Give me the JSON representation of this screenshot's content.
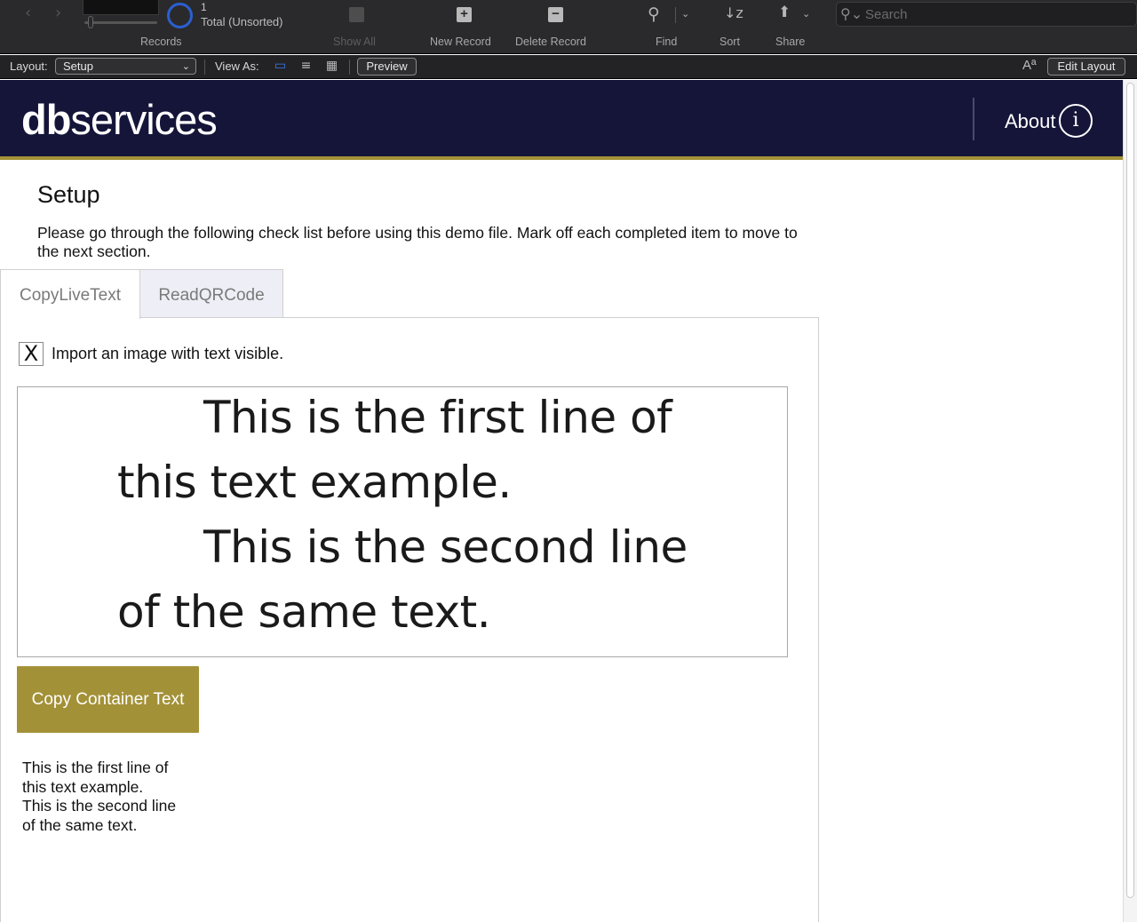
{
  "toolbar": {
    "record_count": "1",
    "record_total": "Total (Unsorted)",
    "records_label": "Records",
    "show_all_label": "Show All",
    "new_record_label": "New Record",
    "delete_record_label": "Delete Record",
    "find_label": "Find",
    "sort_label": "Sort",
    "share_label": "Share",
    "search_placeholder": "Search"
  },
  "layout_bar": {
    "layout_label": "Layout:",
    "layout_value": "Setup",
    "view_as_label": "View As:",
    "preview_label": "Preview",
    "edit_layout_label": "Edit Layout",
    "text_size_glyph": "Aª"
  },
  "header": {
    "logo_bold": "db",
    "logo_rest": "services",
    "about_label": "About",
    "about_icon_glyph": "i"
  },
  "page": {
    "title": "Setup",
    "description": "Please go through the following check list before using this demo file. Mark off each completed item to move to the next section."
  },
  "tabs": [
    {
      "label": "CopyLiveText",
      "active": true
    },
    {
      "label": "ReadQRCode",
      "active": false
    }
  ],
  "checklist": {
    "checked": true,
    "check_glyph": "X",
    "label": "Import an image with text visible."
  },
  "image": {
    "lines": [
      "This is the first line of",
      "this text example.",
      "This is the second line",
      "of the same text."
    ]
  },
  "copy_button_label": "Copy Container Text",
  "result_text": [
    "This is the first line of",
    "this text example.",
    "This is the second line",
    "of the same text."
  ],
  "colors": {
    "header_bg": "#15153a",
    "accent_gold": "#a39137",
    "toolbar_bg": "#2a2a2c",
    "tab_inactive_bg": "#eeeef6"
  }
}
